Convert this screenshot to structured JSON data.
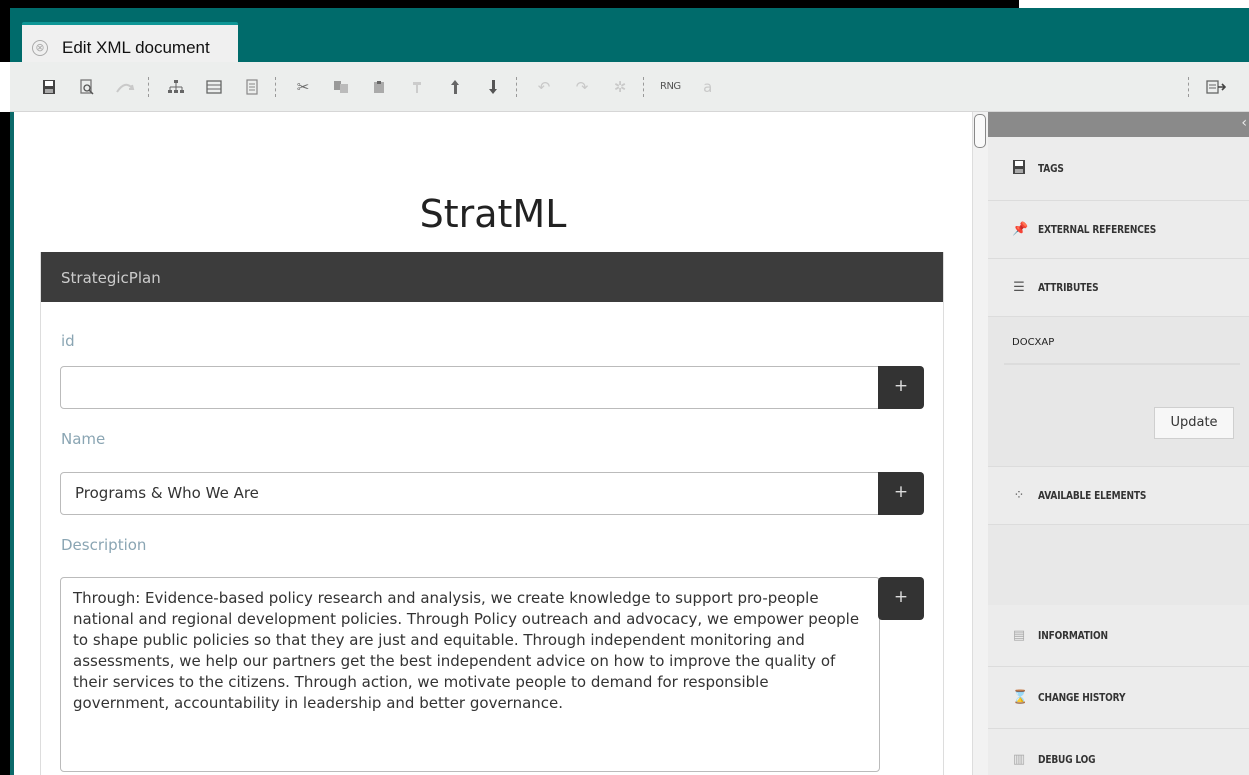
{
  "tab": {
    "label": "Edit XML document",
    "close_glyph": "⊗"
  },
  "toolbar": {
    "buttons": [
      "save-icon",
      "preview-icon",
      "reload-icon",
      "tree-icon",
      "table-icon",
      "document-icon",
      "cut-icon",
      "copy-icon",
      "paste-icon",
      "paste-before-icon",
      "move-up-icon",
      "move-down-icon",
      "undo-icon",
      "redo-icon",
      "validate-icon"
    ],
    "rng_label": "RNG",
    "export_icon": "export-icon"
  },
  "document": {
    "title": "StratML",
    "panel_header": "StrategicPlan",
    "fields": {
      "id": {
        "label": "id",
        "value": ""
      },
      "name": {
        "label": "Name",
        "value": "Programs & Who We Are"
      },
      "description": {
        "label": "Description",
        "value": "Through: Evidence-based policy research and analysis, we create knowledge to support pro-people national and regional development policies. Through Policy outreach and advocacy, we empower people to shape public policies so that they are just and equitable. Through independent monitoring and assessments, we help our partners get the best independent advice on how to improve the quality of their services to the citizens. Through action, we motivate people to demand for responsible government, accountability in leadership and better governance."
      }
    },
    "plus_label": "+"
  },
  "sidebar": {
    "collapse_glyph": "‹",
    "tags": "TAGS",
    "external_references": "EXTERNAL REFERENCES",
    "attributes": "ATTRIBUTES",
    "attribute_name": "DOCXAP",
    "update_label": "Update",
    "available_elements": "AVAILABLE ELEMENTS",
    "information": "INFORMATION",
    "change_history": "CHANGE HISTORY",
    "debug_log": "DEBUG LOG"
  },
  "colors": {
    "tabbar": "#006b6b",
    "panel_header": "#3c3c3c",
    "label": "#8aa5b3"
  }
}
